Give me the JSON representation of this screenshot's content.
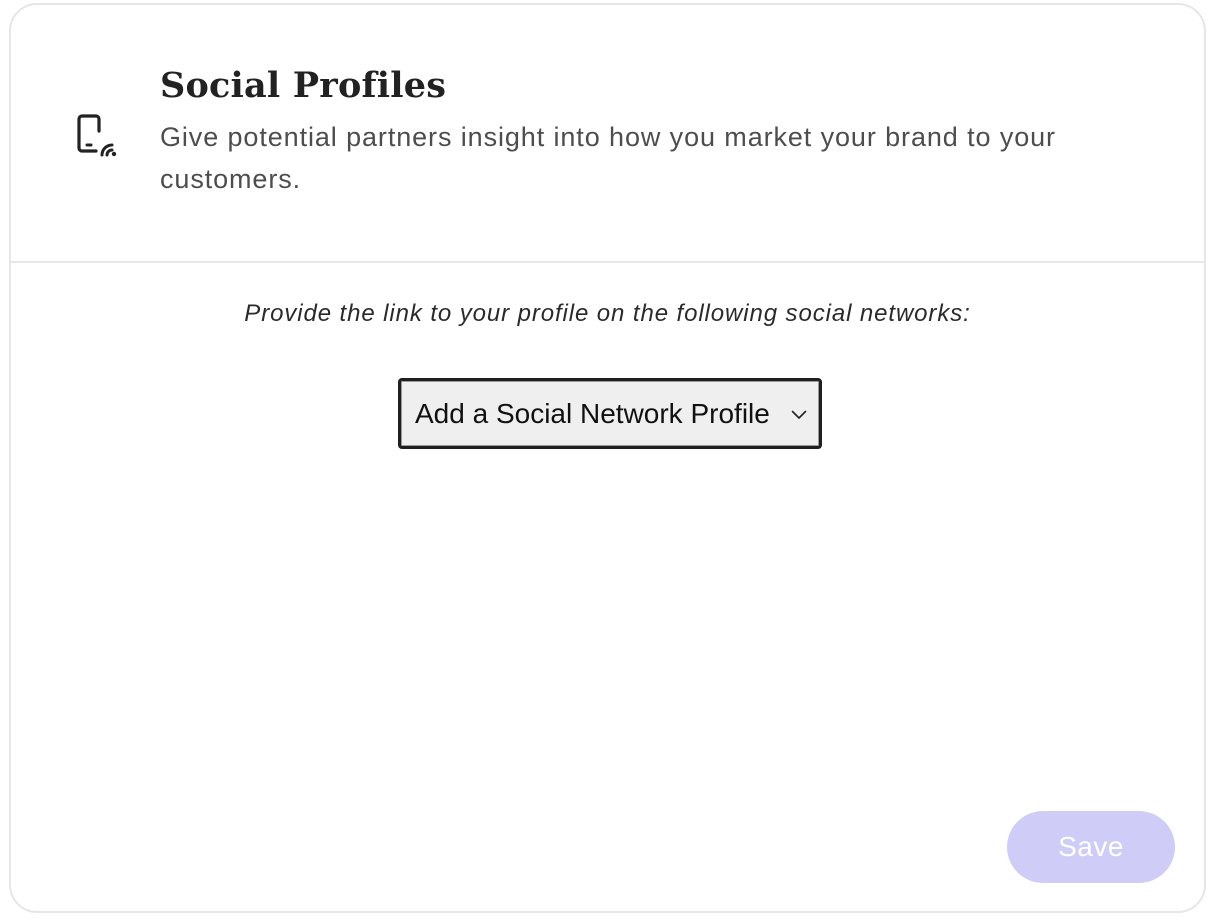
{
  "section": {
    "icon": "phone-wifi-icon",
    "title": "Social Profiles",
    "subtitle": "Give potential partners insight into how you market your brand to your customers."
  },
  "form": {
    "instruction": "Provide the link to your profile on the following social networks:",
    "select": {
      "selected_label": "Add a Social Network Profile",
      "icon": "chevron-down-icon"
    },
    "save_label": "Save",
    "save_disabled": true
  },
  "colors": {
    "save_button_bg": "#cfcdf7",
    "save_button_text": "#ffffff",
    "title_text": "#222222",
    "subtitle_text": "#4d4d4d",
    "border": "#e6e6e6"
  }
}
